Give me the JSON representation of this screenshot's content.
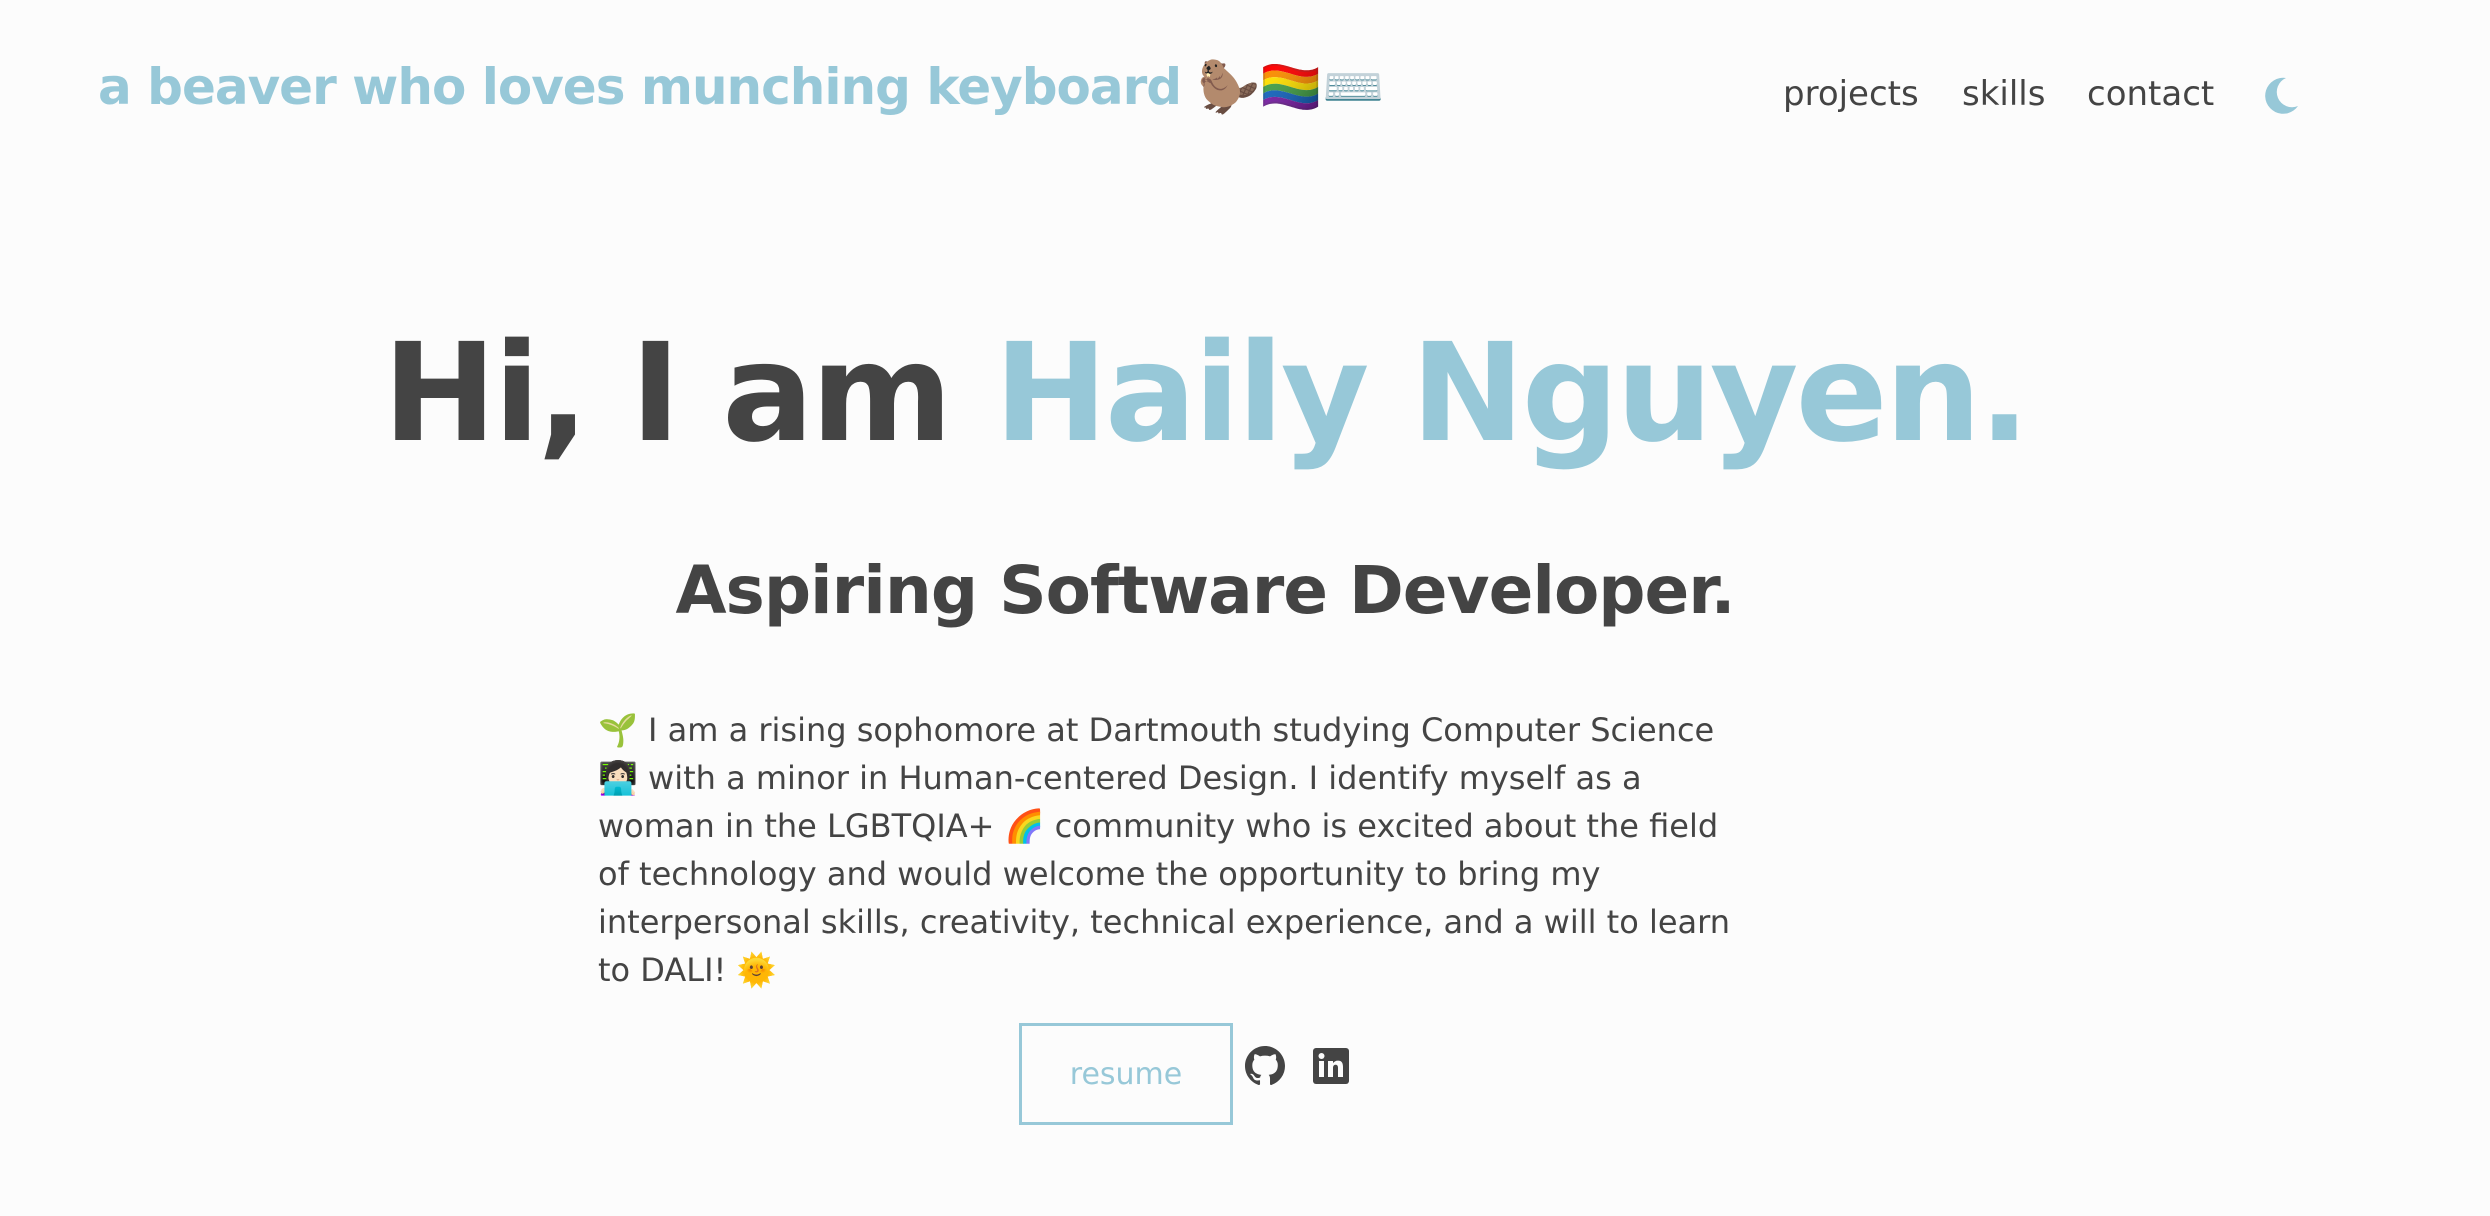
{
  "header": {
    "site_title": "a beaver who loves munching keyboard",
    "site_title_emoji": "🦫🏳️‍🌈⌨️",
    "nav": [
      {
        "label": "projects"
      },
      {
        "label": "skills"
      },
      {
        "label": "contact"
      }
    ],
    "theme_toggle_icon": "moon-icon"
  },
  "hero": {
    "greeting": "Hi, I am",
    "name": "Haily Nguyen.",
    "subtitle": "Aspiring Software Developer.",
    "bio": "🌱 I am a rising sophomore at Dartmouth studying Computer Science 👩🏻‍💻 with a minor in Human-centered Design. I identify myself as a woman in the LGBTQIA+ 🌈 community who is excited about the field of technology and would welcome the opportunity to bring my interpersonal skills, creativity, technical experience, and a will to learn to DALI! 🌞",
    "resume_label": "resume",
    "social_icons": [
      "github-icon",
      "linkedin-icon"
    ]
  },
  "colors": {
    "accent": "#97c8d8",
    "text": "#444444",
    "background": "#fcfcfc"
  }
}
